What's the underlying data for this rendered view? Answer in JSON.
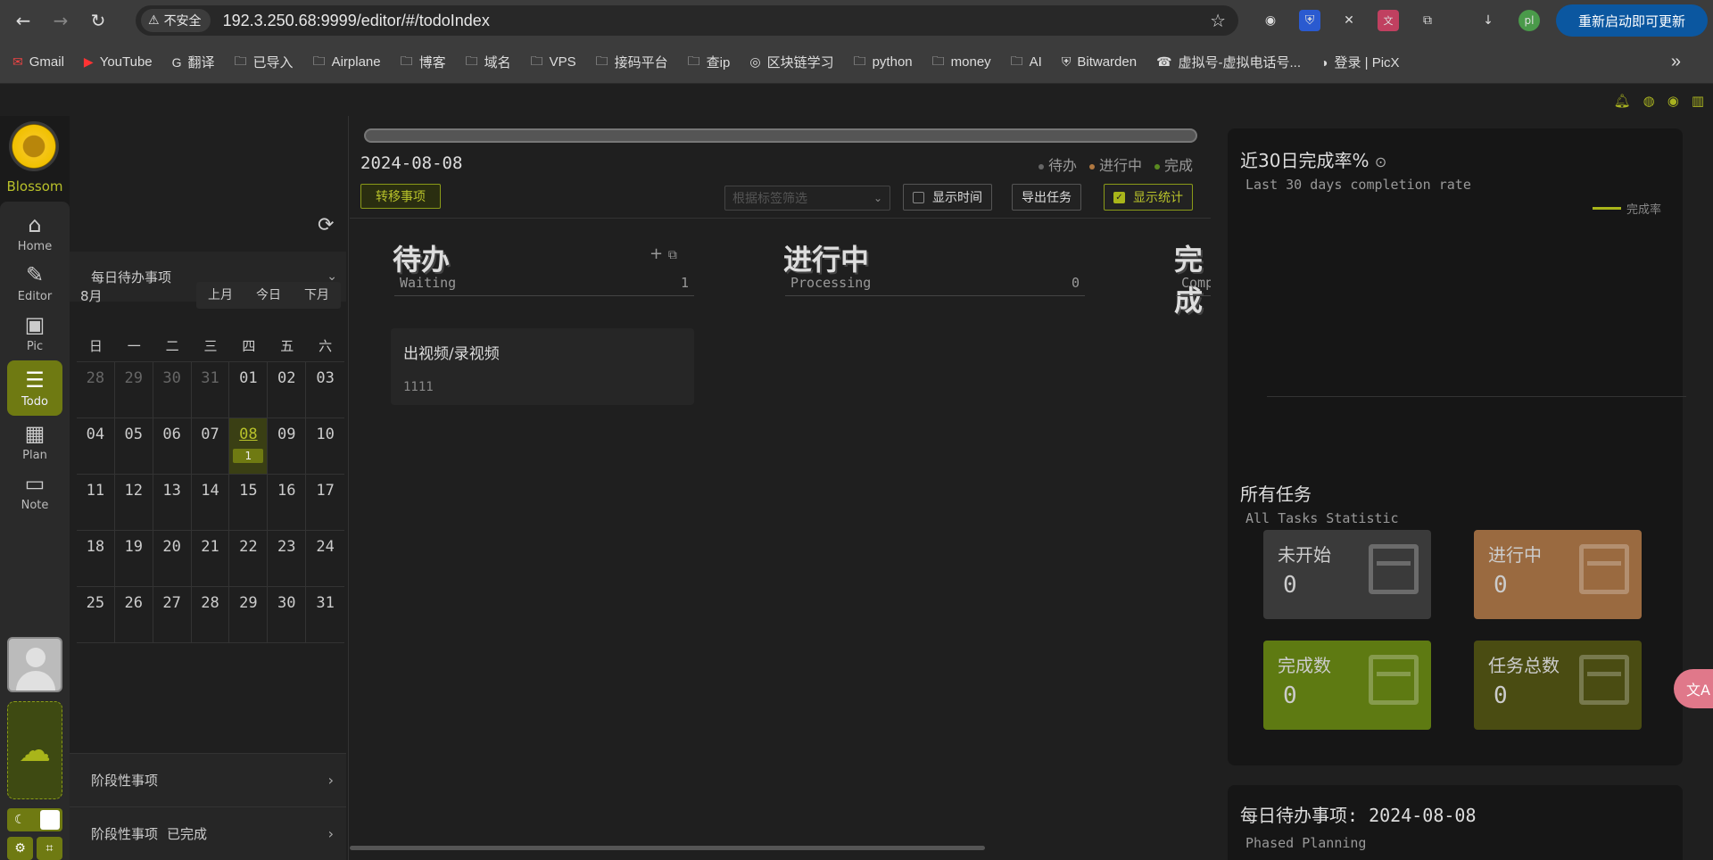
{
  "browser": {
    "insecure_label": "不安全",
    "url": "192.3.250.68:9999/editor/#/todoIndex",
    "update_button": "重新启动即可更新",
    "profile": "pl",
    "bookmarks": [
      {
        "icon": "gmail-icon",
        "label": "Gmail"
      },
      {
        "icon": "youtube-icon",
        "label": "YouTube"
      },
      {
        "icon": "translate-icon",
        "label": "翻译"
      },
      {
        "icon": "folder-icon",
        "label": "已导入"
      },
      {
        "icon": "folder-icon",
        "label": "Airplane"
      },
      {
        "icon": "folder-icon",
        "label": "博客"
      },
      {
        "icon": "folder-icon",
        "label": "域名"
      },
      {
        "icon": "folder-icon",
        "label": "VPS"
      },
      {
        "icon": "folder-icon",
        "label": "接码平台"
      },
      {
        "icon": "folder-icon",
        "label": "查ip"
      },
      {
        "icon": "globe-icon",
        "label": "区块链学习"
      },
      {
        "icon": "folder-icon",
        "label": "python"
      },
      {
        "icon": "folder-icon",
        "label": "money"
      },
      {
        "icon": "folder-icon",
        "label": "AI"
      },
      {
        "icon": "bitwarden-icon",
        "label": "Bitwarden"
      },
      {
        "icon": "phone-icon",
        "label": "虚拟号-虚拟电话号..."
      },
      {
        "icon": "picx-icon",
        "label": "登录 | PicX"
      }
    ]
  },
  "app": {
    "logo_text": "Blossom",
    "nav": [
      {
        "id": "home",
        "icon": "home-icon",
        "label": "Home"
      },
      {
        "id": "editor",
        "icon": "editor-icon",
        "label": "Editor"
      },
      {
        "id": "pic",
        "icon": "image-icon",
        "label": "Pic"
      },
      {
        "id": "todo",
        "icon": "todo-icon",
        "label": "Todo",
        "active": true
      },
      {
        "id": "plan",
        "icon": "calendar-icon",
        "label": "Plan"
      },
      {
        "id": "note",
        "icon": "ticket-icon",
        "label": "Note"
      }
    ]
  },
  "calendar": {
    "section_title": "每日待办事项",
    "month": "8月",
    "prev": "上月",
    "today": "今日",
    "next": "下月",
    "weekdays": [
      "日",
      "一",
      "二",
      "三",
      "四",
      "五",
      "六"
    ],
    "weeks": [
      [
        "28",
        "29",
        "30",
        "31",
        "01",
        "02",
        "03"
      ],
      [
        "04",
        "05",
        "06",
        "07",
        "08",
        "09",
        "10"
      ],
      [
        "11",
        "12",
        "13",
        "14",
        "15",
        "16",
        "17"
      ],
      [
        "18",
        "19",
        "20",
        "21",
        "22",
        "23",
        "24"
      ],
      [
        "25",
        "26",
        "27",
        "28",
        "29",
        "30",
        "31"
      ]
    ],
    "today_badge": "1",
    "phased": "阶段性事项",
    "phased_done": "阶段性事项",
    "phased_done_suffix": "已完成"
  },
  "board": {
    "date": "2024-08-08",
    "legend": [
      "待办",
      "进行中",
      "完成"
    ],
    "legend_colors": [
      "#666666",
      "#b07840",
      "#5a8a20"
    ],
    "transfer_button": "转移事项",
    "filter_placeholder": "根据标签筛选",
    "show_time": "显示时间",
    "export": "导出任务",
    "show_stats": "显示统计",
    "columns": [
      {
        "title": "待办",
        "subtitle": "Waiting",
        "count": "1"
      },
      {
        "title": "进行中",
        "subtitle": "Processing",
        "count": "0"
      },
      {
        "title": "完成",
        "subtitle": "Completed",
        "count": ""
      }
    ],
    "card": {
      "title": "出视频/录视频",
      "desc": "1111"
    }
  },
  "stats": {
    "rate_title": "近30日完成率%",
    "rate_sub": "Last 30 days completion rate",
    "rate_legend": "完成率",
    "all_title": "所有任务",
    "all_sub": "All Tasks Statistic",
    "cards": [
      {
        "label": "未开始",
        "value": "0",
        "color": "#3a3a3a"
      },
      {
        "label": "进行中",
        "value": "0",
        "color": "#9a6a40"
      },
      {
        "label": "完成数",
        "value": "0",
        "color": "#5e7a12"
      },
      {
        "label": "任务总数",
        "value": "0",
        "color": "#4a4c12"
      }
    ],
    "daily_title": "每日待办事项: 2024-08-08",
    "daily_sub": "Phased Planning"
  },
  "translate_label": "文A"
}
